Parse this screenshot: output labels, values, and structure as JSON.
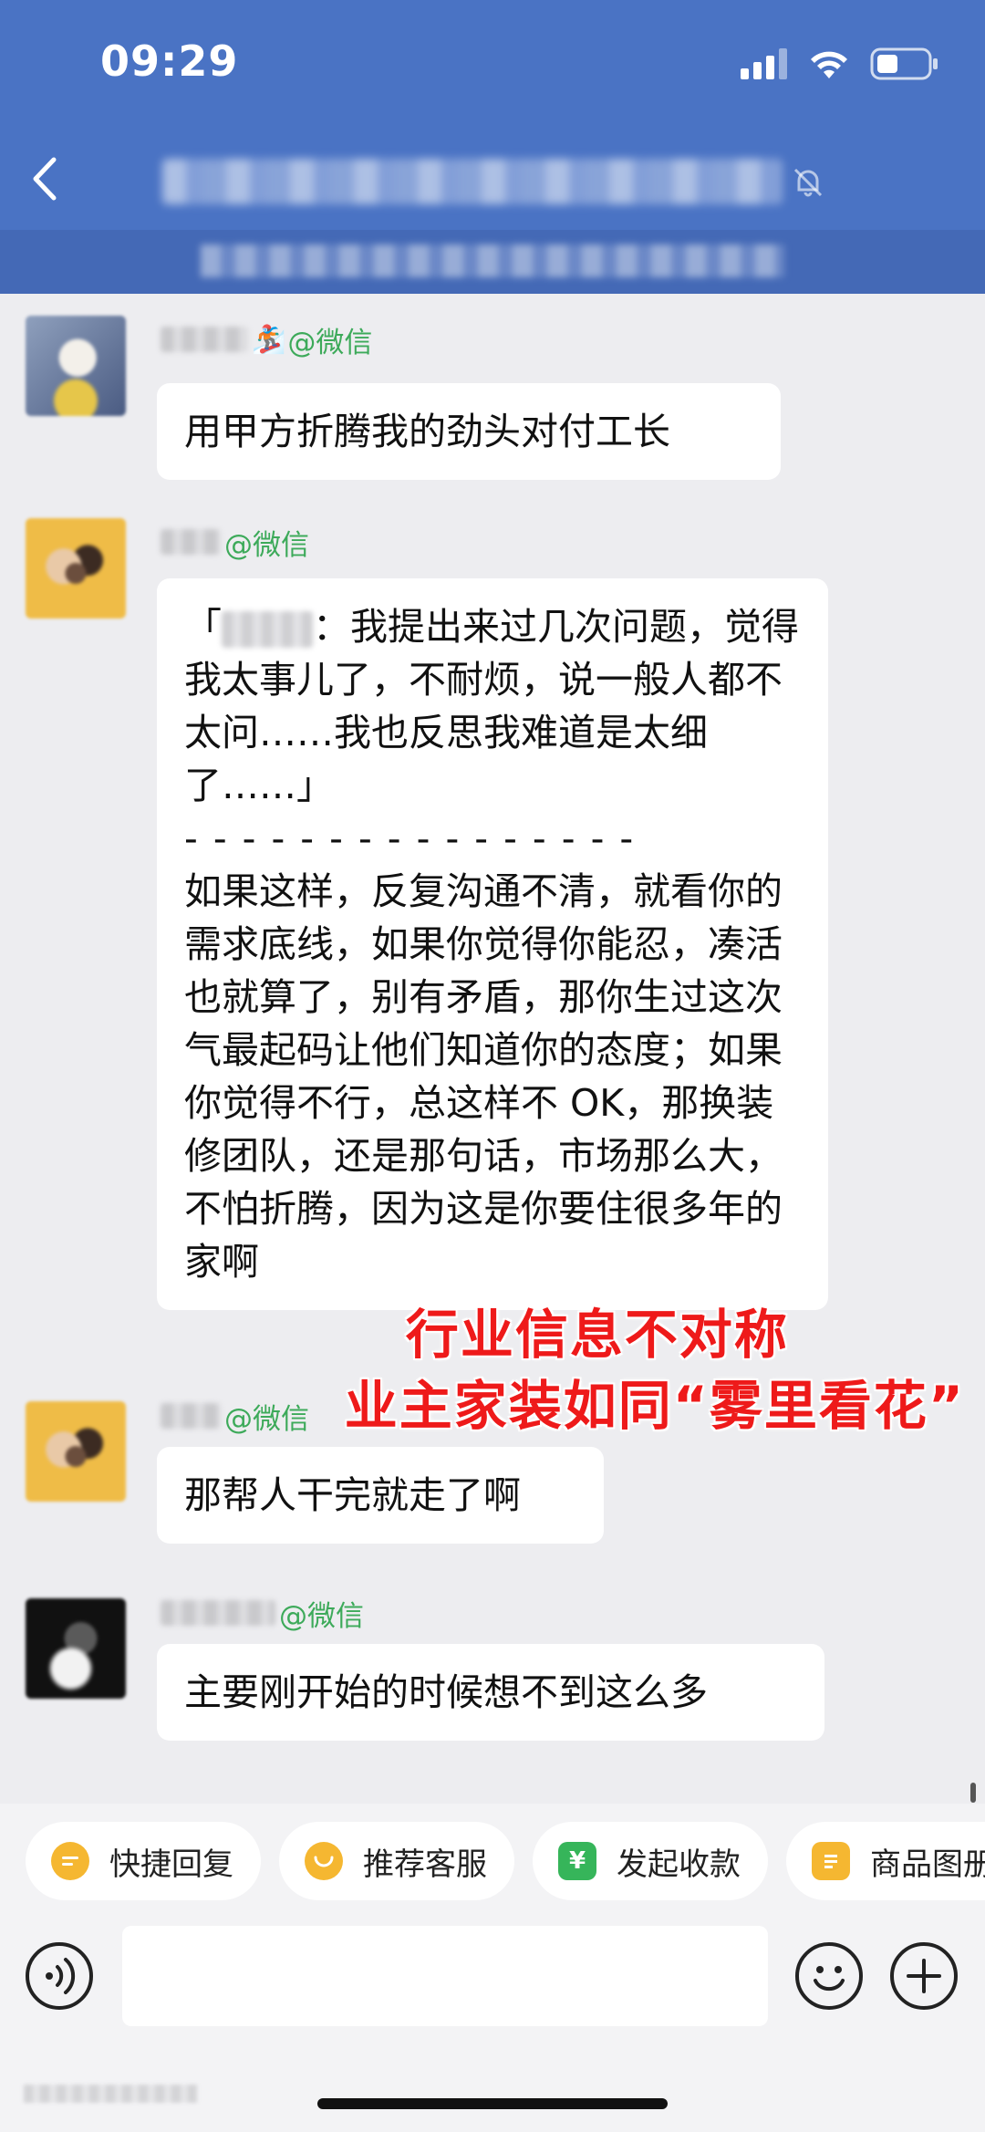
{
  "status_bar": {
    "time": "09:29",
    "icons": [
      "signal-icon",
      "wifi-icon",
      "battery-icon"
    ]
  },
  "nav": {
    "back_icon": "chevron-left-icon",
    "title": "",
    "mute_icon": "bell-slash-icon",
    "subtitle": ""
  },
  "messages": [
    {
      "sender_suffix": "@微信",
      "sender_emoji": "🏂",
      "text": "用甲方折腾我的劲头对付工长"
    },
    {
      "sender_suffix": "@微信",
      "quote_open": "「",
      "quote_rest": "：我提出来过几次问题，觉得我太事儿了，不耐烦，说一般人都不太问……我也反思我难道是太细了……」",
      "divider": "- - - - - - - - - - - - - - - -",
      "text": "如果这样，反复沟通不清，就看你的需求底线，如果你觉得你能忍，凑活也就算了，别有矛盾，那你生过这次气最起码让他们知道你的态度；如果你觉得不行，总这样不 OK，那换装修团队，还是那句话，市场那么大，不怕折腾，因为这是你要住很多年的家啊"
    },
    {
      "sender_suffix": "@微信",
      "text": "那帮人干完就走了啊"
    },
    {
      "sender_suffix": "@微信",
      "text": "主要刚开始的时候想不到这么多"
    }
  ],
  "overlay": {
    "line1": "行业信息不对称",
    "line2": "业主家装如同“雾里看花”"
  },
  "quick_actions": [
    {
      "label": "快捷回复",
      "icon": "message-icon",
      "color": "#f5b731"
    },
    {
      "label": "推荐客服",
      "icon": "smile-icon",
      "color": "#f5b731"
    },
    {
      "label": "发起收款",
      "icon": "yen-icon",
      "color": "#36b55a"
    },
    {
      "label": "商品图册",
      "icon": "catalog-icon",
      "color": "#f5b731"
    }
  ],
  "input": {
    "placeholder": "",
    "voice_icon": "voice-icon",
    "emoji_icon": "emoji-icon",
    "plus_icon": "plus-icon"
  },
  "watermark": ""
}
